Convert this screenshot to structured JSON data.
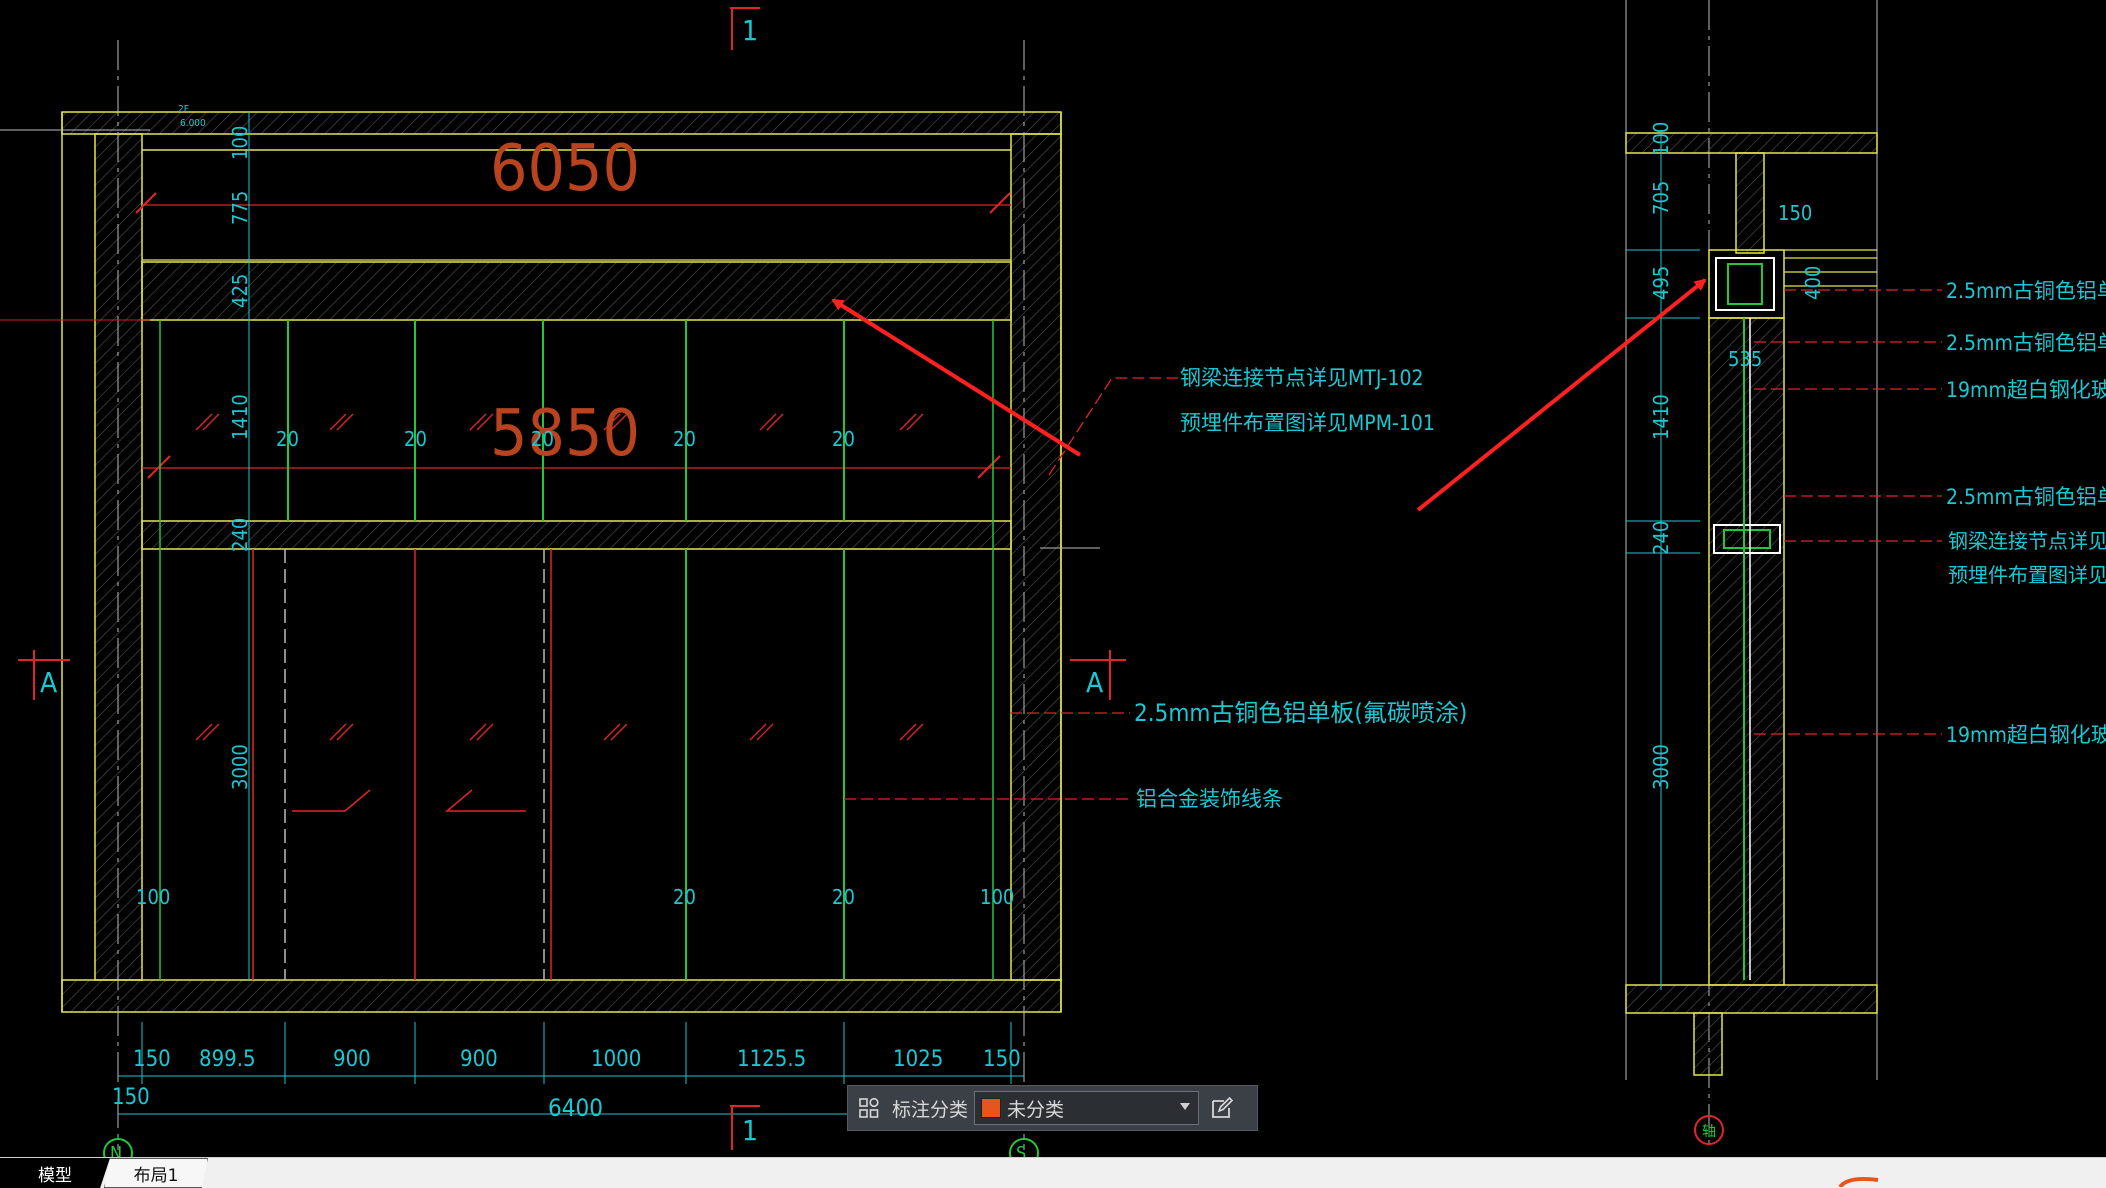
{
  "colors": {
    "background": "#000000",
    "frame_yellow": "#e6e64a",
    "dim_cyan": "#19c8d2",
    "red": "#e0252a",
    "green": "#22c83c",
    "orange_text": "#b8431e",
    "annot_arrow": "#ff2020",
    "category_swatch": "#e8551c"
  },
  "elevation": {
    "section_mark_top": "1",
    "section_mark_bottom": "1",
    "section_mark_left": "A",
    "section_mark_right": "A",
    "level_label": "2F",
    "level_value": "6.000",
    "overall_width_upper": "6050",
    "inner_width": "5850",
    "vertical_dims": [
      "100",
      "775",
      "425",
      "1410",
      "240",
      "3000"
    ],
    "mullion_dims_upper": [
      "20",
      "20",
      "20",
      "20",
      "20"
    ],
    "mullion_dims_lower": [
      "100",
      "20",
      "20",
      "100"
    ],
    "bottom_dims": [
      "150",
      "899.5",
      "900",
      "900",
      "1000",
      "1125.5",
      "1025",
      "150"
    ],
    "bottom_start": "150",
    "overall_width_bottom": "6400",
    "axis_left": "N",
    "axis_right": "S",
    "notes": [
      "钢梁连接节点详见MTJ-102",
      "预埋件布置图详见MPM-101",
      "2.5mm古铜色铝单板(氟碳喷涂)",
      "铝合金装饰线条"
    ]
  },
  "section": {
    "vertical_dims": [
      "100",
      "705",
      "495",
      "1410",
      "240",
      "3000"
    ],
    "dim_150": "150",
    "dim_400": "400",
    "dim_535": "535",
    "axis_label": "轴",
    "notes": [
      "2.5mm古铜色铝单板(氟碳",
      "2.5mm古铜色铝单板(氟碳",
      "19mm超白钢化玻璃",
      "2.5mm古铜色铝单板(氟碳",
      "钢梁连接节点详见MTJ-10",
      "预埋件布置图详见MPM-1",
      "19mm超白钢化玻璃"
    ]
  },
  "toolbar": {
    "grid_icon": "grid-icon",
    "label": "标注分类",
    "selected": "未分类",
    "edit_icon": "edit-icon"
  },
  "tabs": [
    "模型",
    "布局1"
  ]
}
